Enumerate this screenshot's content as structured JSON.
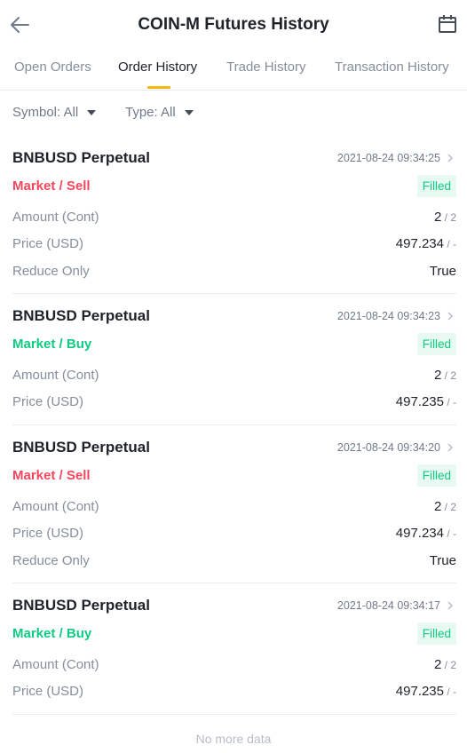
{
  "header": {
    "title": "COIN-M Futures History"
  },
  "tabs": [
    {
      "label": "Open Orders"
    },
    {
      "label": "Order History"
    },
    {
      "label": "Trade History"
    },
    {
      "label": "Transaction History"
    }
  ],
  "filters": {
    "symbol_label": "Symbol: All",
    "type_label": "Type: All"
  },
  "orders": [
    {
      "symbol": "BNBUSD Perpetual",
      "time": "2021-08-24 09:34:25",
      "side": "Market / Sell",
      "status": "Filled",
      "amount_label": "Amount (Cont)",
      "amount_value": "2",
      "amount_sub": " / 2",
      "price_label": "Price (USD)",
      "price_value": "497.234",
      "price_sub": " / -",
      "reduce_label": "Reduce Only",
      "reduce_value": "True"
    },
    {
      "symbol": "BNBUSD Perpetual",
      "time": "2021-08-24 09:34:23",
      "side": "Market / Buy",
      "status": "Filled",
      "amount_label": "Amount (Cont)",
      "amount_value": "2",
      "amount_sub": " / 2",
      "price_label": "Price (USD)",
      "price_value": "497.235",
      "price_sub": " / -"
    },
    {
      "symbol": "BNBUSD Perpetual",
      "time": "2021-08-24 09:34:20",
      "side": "Market / Sell",
      "status": "Filled",
      "amount_label": "Amount (Cont)",
      "amount_value": "2",
      "amount_sub": " / 2",
      "price_label": "Price (USD)",
      "price_value": "497.234",
      "price_sub": " / -",
      "reduce_label": "Reduce Only",
      "reduce_value": "True"
    },
    {
      "symbol": "BNBUSD Perpetual",
      "time": "2021-08-24 09:34:17",
      "side": "Market / Buy",
      "status": "Filled",
      "amount_label": "Amount (Cont)",
      "amount_value": "2",
      "amount_sub": " / 2",
      "price_label": "Price (USD)",
      "price_value": "497.235",
      "price_sub": " / -"
    }
  ],
  "footer": {
    "no_more": "No more data"
  },
  "colors": {
    "sell": "#f6465d",
    "buy": "#0ecb81",
    "accent": "#f0b90b"
  },
  "icons": {
    "back": "arrow-left-icon",
    "calendar": "calendar-icon",
    "filter": "caret-down-icon",
    "detail": "chevron-right-icon"
  }
}
